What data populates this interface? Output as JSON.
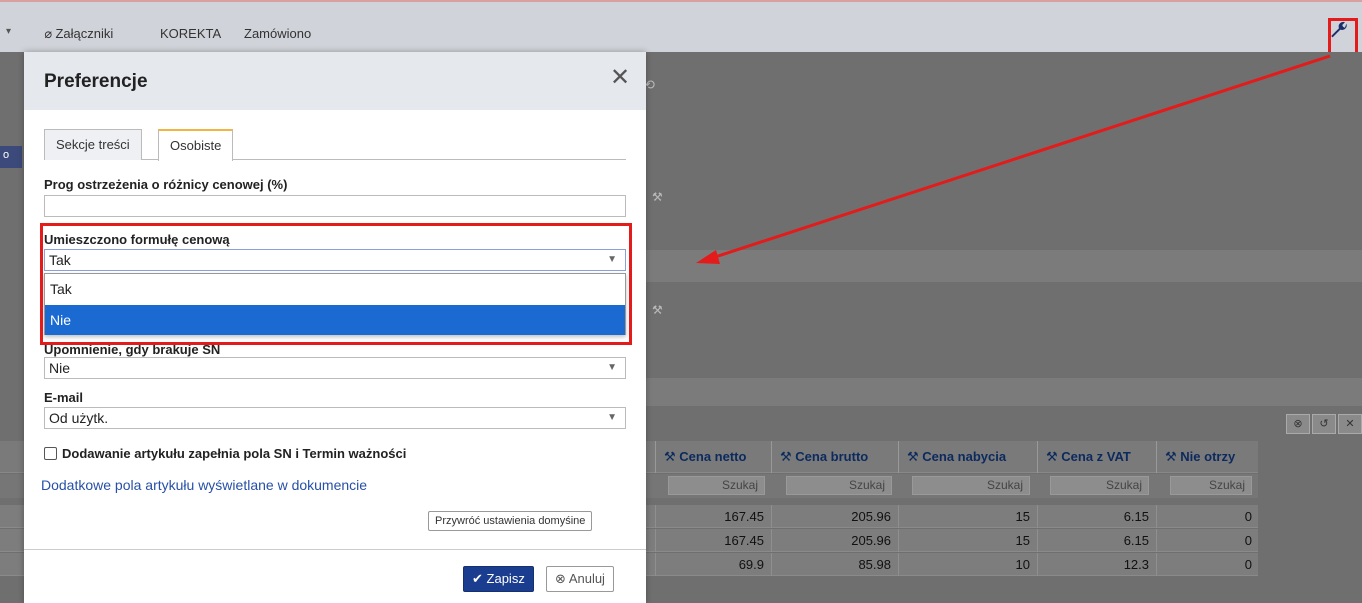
{
  "toolbar": {
    "items": [
      "Załączniki",
      "KOREKTA",
      "Zamówiono"
    ]
  },
  "left_tab_label": "o",
  "modal": {
    "title": "Preferencje",
    "tabs": [
      "Sekcje treści",
      "Osobiste"
    ],
    "fields": {
      "price_warning_label": "Prog ostrzeżenia o różnicy cenowej (%)",
      "price_warning_value": "",
      "formula_label": "Umieszczono formułę cenową",
      "formula_value": "Tak",
      "formula_options": [
        "Tak",
        "Nie"
      ],
      "sn_label": "Upomnienie, gdy brakuje SN",
      "sn_value": "Nie",
      "email_label": "E-mail",
      "email_value": "Od użytk."
    },
    "checkbox_label": "Dodawanie artykułu zapełnia pola SN i Termin ważności",
    "link_text": "Dodatkowe pola artykułu wyświetlane w dokumencie",
    "restore_label": "Przywróć ustawienia domyśine",
    "save_label": "Zapisz",
    "cancel_label": "Anuluj"
  },
  "grid": {
    "columns": [
      "Cena netto",
      "Cena brutto",
      "Cena nabycia",
      "Cena z VAT",
      "Nie otrzy"
    ],
    "search_placeholder": "Szukaj",
    "rows": [
      [
        "167.45",
        "205.96",
        "15",
        "6.15",
        "0"
      ],
      [
        "167.45",
        "205.96",
        "15",
        "6.15",
        "0"
      ],
      [
        "69.9",
        "85.98",
        "10",
        "12.3",
        "0"
      ]
    ]
  },
  "colors": {
    "accent_red": "#e31b1b",
    "select_highlight": "#1a6ad1",
    "save_button": "#1b3d8f"
  },
  "icons": [
    "paperclip-icon",
    "wrench-icon",
    "close-icon",
    "check-icon",
    "cancel-circle-icon",
    "chevron-down-icon"
  ]
}
